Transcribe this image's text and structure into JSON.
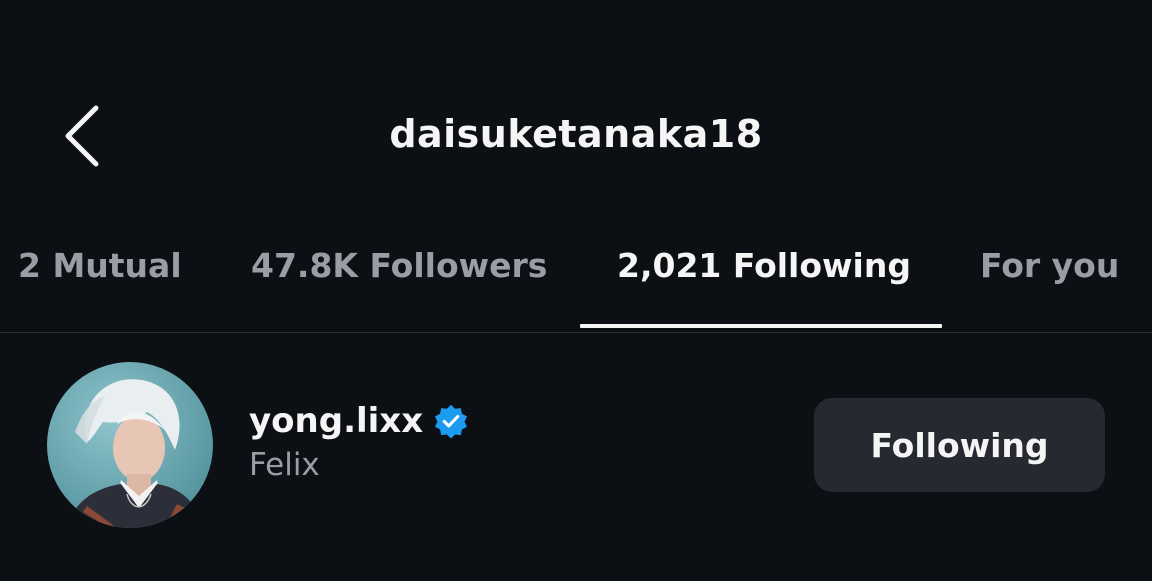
{
  "header": {
    "title": "daisuketanaka18",
    "back_icon": "chevron-left-icon"
  },
  "tabs": [
    {
      "label": "2 Mutual",
      "active": false
    },
    {
      "label": "47.8K Followers",
      "active": false
    },
    {
      "label": "2,021 Following",
      "active": true
    },
    {
      "label": "For you",
      "active": false
    }
  ],
  "list": {
    "items": [
      {
        "username": "yong.lixx",
        "verified": true,
        "full_name": "Felix",
        "button_label": "Following",
        "avatar_icon": "profile-photo"
      }
    ]
  },
  "colors": {
    "background": "#0c0f14",
    "primary_text": "#f5f5f5",
    "secondary_text": "#9a9da3",
    "button_bg": "#26292f",
    "verified_blue": "#1d9bf0",
    "divider": "#2a2d33"
  }
}
